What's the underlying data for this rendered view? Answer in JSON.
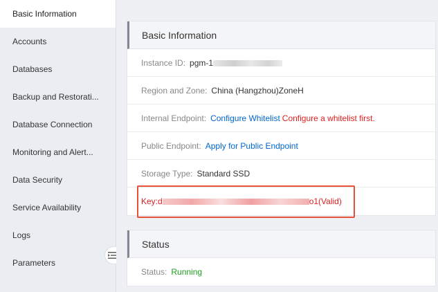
{
  "sidebar": {
    "items": [
      {
        "label": "Basic Information",
        "active": true
      },
      {
        "label": "Accounts"
      },
      {
        "label": "Databases"
      },
      {
        "label": "Backup and Restorati..."
      },
      {
        "label": "Database Connection"
      },
      {
        "label": "Monitoring and Alert..."
      },
      {
        "label": "Data Security"
      },
      {
        "label": "Service Availability"
      },
      {
        "label": "Logs"
      },
      {
        "label": "Parameters"
      }
    ],
    "collapse_icon": "collapse-menu-icon"
  },
  "basic_info": {
    "title": "Basic Information",
    "instance_id_label": "Instance ID:",
    "instance_id_value": "pgm-1",
    "region_label": "Region and Zone:",
    "region_value": "China (Hangzhou)ZoneH",
    "internal_label": "Internal Endpoint:",
    "internal_link": "Configure Whitelist",
    "internal_warning": "Configure a whitelist first.",
    "public_label": "Public Endpoint:",
    "public_link": "Apply for Public Endpoint",
    "storage_label": "Storage Type:",
    "storage_value": "Standard SSD",
    "key_prefix": "Key:d",
    "key_suffix": "o1(Valid)"
  },
  "status": {
    "title": "Status",
    "status_label": "Status:",
    "status_value": "Running"
  },
  "colors": {
    "link": "#0066cc",
    "warning": "#e02020",
    "running": "#1e9e1e",
    "highlight_box": "#e8503a"
  }
}
